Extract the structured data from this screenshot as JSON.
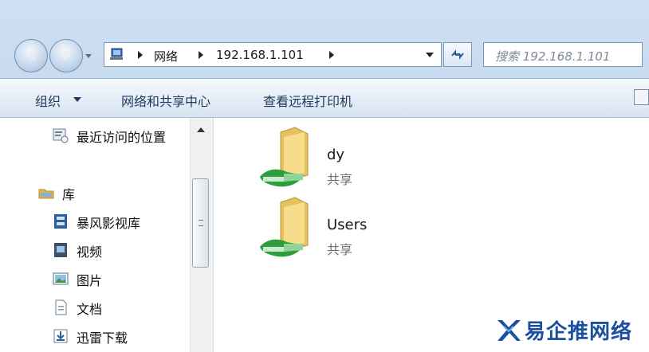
{
  "address_bar": {
    "segments": [
      "网络",
      "192.168.1.101"
    ]
  },
  "search": {
    "placeholder": "搜索 192.168.1.101"
  },
  "toolbar": {
    "organize": "组织",
    "network_sharing_center": "网络和共享中心",
    "view_remote_printers": "查看远程打印机"
  },
  "sidebar": {
    "items": [
      {
        "label": "最近访问的位置",
        "icon": "recent-places-icon"
      },
      {
        "label": "库",
        "icon": "libraries-icon"
      },
      {
        "label": "暴风影视库",
        "icon": "video-library-icon"
      },
      {
        "label": "视频",
        "icon": "videos-icon"
      },
      {
        "label": "图片",
        "icon": "pictures-icon"
      },
      {
        "label": "文档",
        "icon": "documents-icon"
      },
      {
        "label": "迅雷下载",
        "icon": "downloads-icon"
      }
    ]
  },
  "shares": [
    {
      "name": "dy",
      "type": "共享",
      "icon": "shared-folder-icon"
    },
    {
      "name": "Users",
      "type": "共享",
      "icon": "shared-folder-icon"
    }
  ],
  "watermark": {
    "text": "易企推网络"
  },
  "colors": {
    "chrome_blue": "#b9d1ea",
    "command_text": "#1e395b",
    "folder_yellow": "#f2cf6a",
    "share_green": "#2e9e3c",
    "watermark_blue": "#1b4f9f"
  }
}
